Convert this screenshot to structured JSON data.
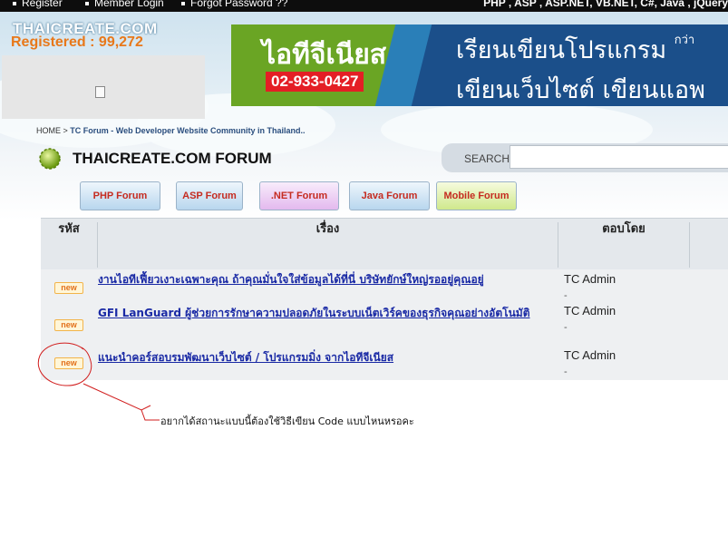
{
  "topbar": {
    "links": [
      "Register",
      "Member Login",
      "Forgot Password ??"
    ],
    "tech": "PHP , ASP , ASP.NET, VB.NET, C#, Java , jQuery"
  },
  "header": {
    "logo": "THAICREATE.COM",
    "registered": "Registered : 99,272"
  },
  "banner": {
    "brand": "ไอทีจีเนียส",
    "phone": "02-933-0427",
    "line1": "เรียนเขียนโปรแกรม",
    "line1_suffix": "กว่า",
    "line2": "เขียนเว็บไซต์ เขียนแอพ"
  },
  "breadcrumb": {
    "home": "HOME",
    "arrow": ">",
    "current": "TC Forum - Web Developer Website Community in Thailand.."
  },
  "forum": {
    "title": "THAICREATE.COM FORUM",
    "search_label": "SEARCH",
    "search_value": ""
  },
  "tabs": [
    "PHP Forum",
    "ASP Forum",
    ".NET Forum",
    "Java Forum",
    "Mobile Forum"
  ],
  "table": {
    "headers": [
      "รหัส",
      "เรื่อง",
      "ตอบโดย"
    ],
    "rows": [
      {
        "tag": "new",
        "title": "งานไอทีเฟี้ยวเงาะเฉพาะคุณ ถ้าคุณมั่นใจใส่ข้อมูลได้ที่นี่ บริษัทยักษ์ใหญ่รออยู่คุณอยู่",
        "by": "TC Admin",
        "sub": "-"
      },
      {
        "tag": "new",
        "title": "GFI LanGuard ผู้ช่วยการรักษาความปลอดภัยในระบบเน็ตเวิร์คของธุรกิจคุณอย่างอัตโนมัติ",
        "by": "TC Admin",
        "sub": "-"
      },
      {
        "tag": "new",
        "title": "แนะนำคอร์สอบรมพัฒนาเว็บไซต์ / โปรแกรมมิ่ง จากไอทีจีเนียส",
        "by": "TC Admin",
        "sub": "-"
      }
    ]
  },
  "annotation": "อยากได้สถานะแบบนี้ต้องใช้วิธีเขียน Code แบบไหนหรอคะ",
  "colors": {
    "annotation_ink": "#d11d1d",
    "tab_text": "#c52b20",
    "link": "#1a2aa5",
    "registered": "#e8781a"
  }
}
